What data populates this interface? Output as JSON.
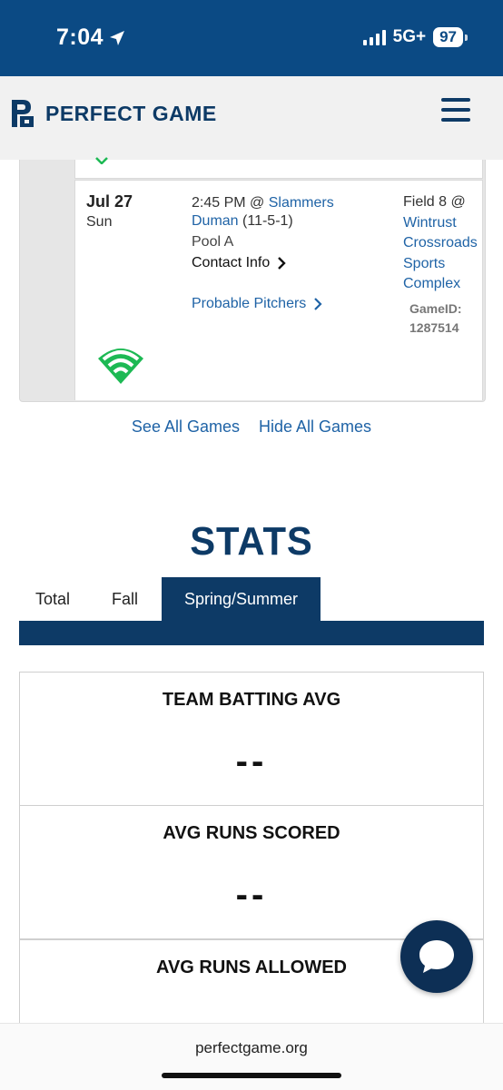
{
  "status_bar": {
    "time": "7:04",
    "network": "5G+",
    "battery": "97"
  },
  "header": {
    "brand": "PERFECT GAME"
  },
  "game": {
    "date": "Jul 27",
    "day": "Sun",
    "time": "2:45 PM @ ",
    "opponent_first": "Slammers",
    "opponent_second": "Duman",
    "record": " (11-5-1)",
    "pool": "Pool A",
    "contact": "Contact Info",
    "pitchers": "Probable Pitchers",
    "field_prefix": "Field 8 @",
    "venue_lines": [
      "Wintrust",
      "Crossroads",
      "Sports",
      "Complex"
    ],
    "game_id_label": "GameID:",
    "game_id": "1287514"
  },
  "links": {
    "see_all": "See All Games",
    "hide_all": "Hide All Games"
  },
  "stats": {
    "title": "STATS",
    "tabs": [
      "Total",
      "Fall",
      "Spring/Summer"
    ],
    "active_tab": "Spring/Summer",
    "boxes": [
      {
        "label": "TEAM BATTING AVG",
        "value": "--"
      },
      {
        "label": "AVG RUNS SCORED",
        "value": "--"
      },
      {
        "label": "AVG RUNS ALLOWED",
        "value": ""
      }
    ]
  },
  "footer": {
    "url": "perfectgame.org"
  },
  "colors": {
    "navy": "#0d3a66",
    "status_blue": "#0b4a84",
    "link_blue": "#1f63a6",
    "green": "#1db954"
  },
  "icons": [
    "location-arrow-icon",
    "signal-icon",
    "menu-icon",
    "chevron-right-icon",
    "wifi-field-icon",
    "chat-icon"
  ]
}
